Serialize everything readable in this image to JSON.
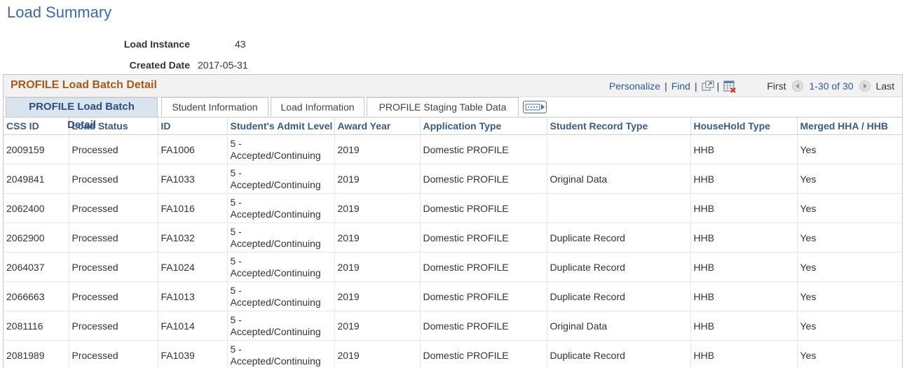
{
  "page": {
    "title": "Load Summary"
  },
  "summary": {
    "load_instance_label": "Load Instance",
    "load_instance_value": "43",
    "created_date_label": "Created Date",
    "created_date_value": "2017-05-31"
  },
  "grid": {
    "title": "PROFILE Load Batch Detail",
    "nav": {
      "personalize": "Personalize",
      "find": "Find",
      "first": "First",
      "range": "1-30 of 30",
      "last": "Last"
    },
    "tabs": [
      {
        "label": "PROFILE Load Batch Detail"
      },
      {
        "label": "Student Information"
      },
      {
        "label": "Load Information"
      },
      {
        "label": "PROFILE Staging Table Data"
      }
    ],
    "columns": [
      "CSS ID",
      "Load Status",
      "ID",
      "Student's Admit Level",
      "Award Year",
      "Application Type",
      "Student Record Type",
      "HouseHold Type",
      "Merged HHA / HHB"
    ],
    "rows": [
      {
        "css_id": "2009159",
        "status": "Processed",
        "id": "FA1006",
        "admit_1": "5 -",
        "admit_2": "Accepted/Continuing",
        "award_year": "2019",
        "app_type": "Domestic PROFILE",
        "record_type": "",
        "household": "HHB",
        "merged": "Yes"
      },
      {
        "css_id": "2049841",
        "status": "Processed",
        "id": "FA1033",
        "admit_1": "5 -",
        "admit_2": "Accepted/Continuing",
        "award_year": "2019",
        "app_type": "Domestic PROFILE",
        "record_type": "Original Data",
        "household": "HHB",
        "merged": "Yes"
      },
      {
        "css_id": "2062400",
        "status": "Processed",
        "id": "FA1016",
        "admit_1": "5 -",
        "admit_2": "Accepted/Continuing",
        "award_year": "2019",
        "app_type": "Domestic PROFILE",
        "record_type": "",
        "household": "HHB",
        "merged": "Yes"
      },
      {
        "css_id": "2062900",
        "status": "Processed",
        "id": "FA1032",
        "admit_1": "5 -",
        "admit_2": "Accepted/Continuing",
        "award_year": "2019",
        "app_type": "Domestic PROFILE",
        "record_type": "Duplicate Record",
        "household": "HHB",
        "merged": "Yes"
      },
      {
        "css_id": "2064037",
        "status": "Processed",
        "id": "FA1024",
        "admit_1": "5 -",
        "admit_2": "Accepted/Continuing",
        "award_year": "2019",
        "app_type": "Domestic PROFILE",
        "record_type": "Duplicate Record",
        "household": "HHB",
        "merged": "Yes"
      },
      {
        "css_id": "2066663",
        "status": "Processed",
        "id": "FA1013",
        "admit_1": "5 -",
        "admit_2": "Accepted/Continuing",
        "award_year": "2019",
        "app_type": "Domestic PROFILE",
        "record_type": "Duplicate Record",
        "household": "HHB",
        "merged": "Yes"
      },
      {
        "css_id": "2081116",
        "status": "Processed",
        "id": "FA1014",
        "admit_1": "5 -",
        "admit_2": "Accepted/Continuing",
        "award_year": "2019",
        "app_type": "Domestic PROFILE",
        "record_type": "Original Data",
        "household": "HHB",
        "merged": "Yes"
      },
      {
        "css_id": "2081989",
        "status": "Processed",
        "id": "FA1039",
        "admit_1": "5 -",
        "admit_2": "Accepted/Continuing",
        "award_year": "2019",
        "app_type": "Domestic PROFILE",
        "record_type": "Duplicate Record",
        "household": "HHB",
        "merged": "Yes"
      }
    ]
  },
  "icons": {
    "zoom": "zoom-icon",
    "download": "download-spreadsheet-icon",
    "prev": "previous-arrow-icon",
    "next": "next-arrow-icon",
    "more_tabs": "show-all-columns-icon"
  }
}
